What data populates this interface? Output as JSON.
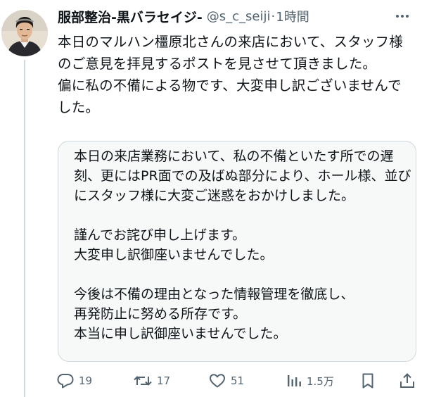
{
  "header": {
    "display_name": "服部整治-黒バラセイジ-",
    "handle": "@s_c_seiji",
    "separator": "·",
    "time": "1時間"
  },
  "tweet": {
    "paragraphs": [
      "本日のマルハン橿原北さんの来店において、スタッフ様のご意見を拝見するポストを見させて頂きました。",
      "偏に私の不備による物です、大変申し訳ございませんでした。"
    ]
  },
  "quote": {
    "blocks": [
      [
        "本日の来店業務において、私の不備といたす所での遅刻、更にはPR面での及ばぬ部分により、ホール様、並びにスタッフ様に大変ご迷惑をおかけしました。"
      ],
      [
        "謹んでお詫び申し上げます。",
        "大変申し訳御座いませんでした。"
      ],
      [
        "今後は不備の理由となった情報管理を徹底し、",
        "再発防止に努める所存です。",
        "本当に申し訳御座いませんでした。"
      ]
    ]
  },
  "actions": {
    "replies": "19",
    "reposts": "17",
    "likes": "51",
    "views": "1.5万"
  },
  "icons": {
    "reply": "reply-icon",
    "repost": "repost-icon",
    "like": "heart-icon",
    "views": "views-icon",
    "bookmark": "bookmark-icon",
    "share": "share-icon",
    "more": "more-icon"
  },
  "colors": {
    "text": "#0f1419",
    "secondary": "#536471",
    "border": "#cfd9de",
    "quote_bg": "#f7f9f9"
  }
}
